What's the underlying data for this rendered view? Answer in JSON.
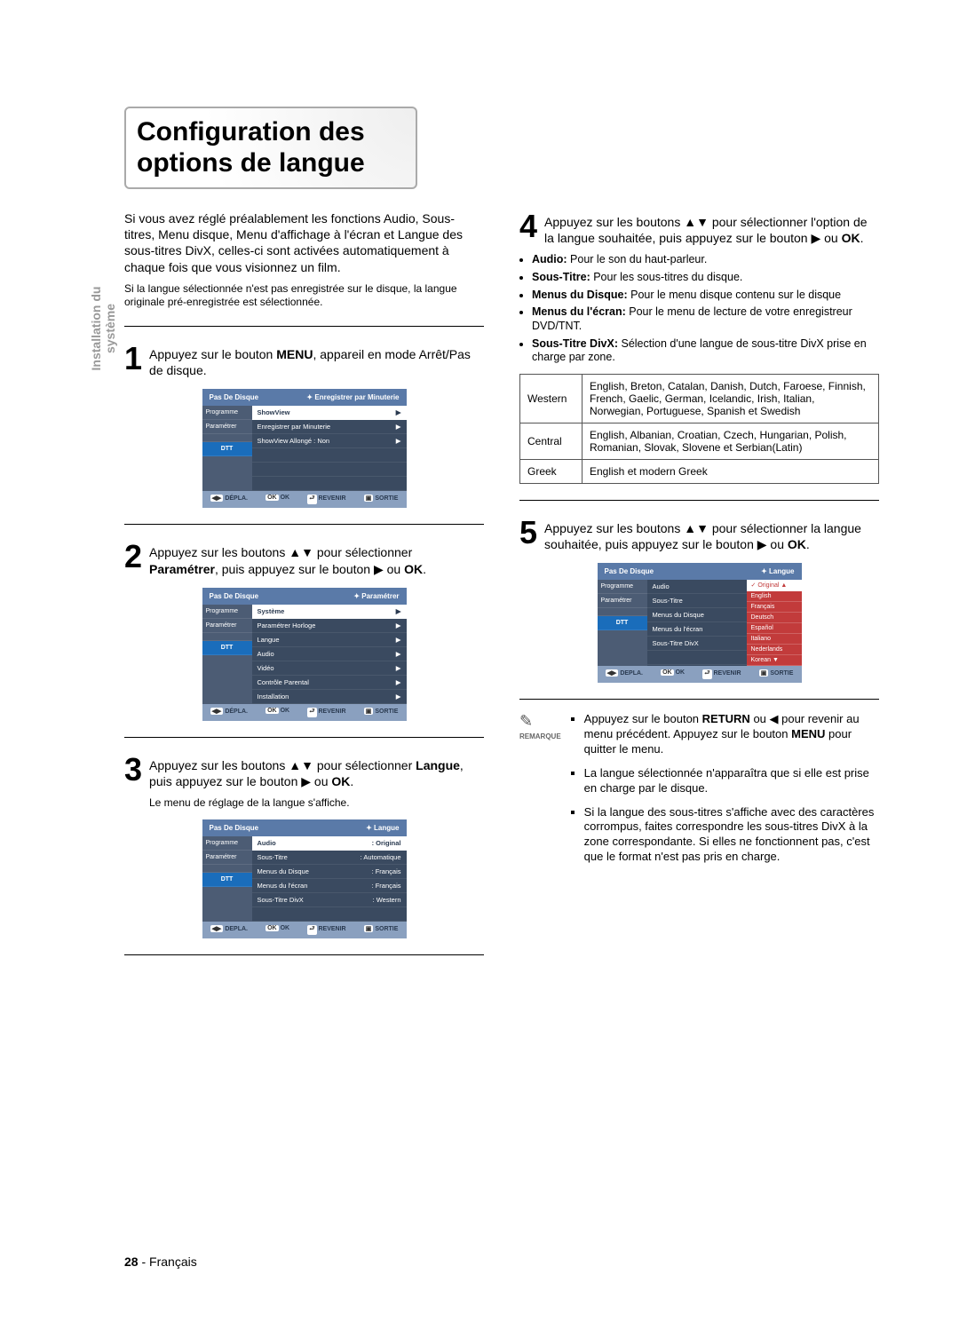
{
  "side_label": "Installation du système",
  "title": "Configuration des options de langue",
  "intro": "Si vous avez réglé préalablement les fonctions Audio, Sous-titres, Menu disque, Menu d'affichage à l'écran et Langue des sous-titres DivX, celles-ci sont activées automatiquement à chaque fois que vous visionnez un film.",
  "intro_small": "Si la langue sélectionnée n'est pas enregistrée sur le disque, la langue originale pré-enregistrée est sélectionnée.",
  "steps": {
    "s1": {
      "n": "1",
      "t": "Appuyez sur le bouton <b>MENU</b>, appareil en mode Arrêt/Pas de disque."
    },
    "s2": {
      "n": "2",
      "t": "Appuyez sur les boutons ▲▼ pour sélectionner <b>Paramétrer</b>, puis appuyez sur le bouton ▶ ou <b>OK</b>."
    },
    "s3": {
      "n": "3",
      "t": "Appuyez sur les boutons ▲▼ pour sélectionner <b>Langue</b>, puis appuyez sur le bouton ▶ ou <b>OK</b>.",
      "sub": "Le menu de réglage de la langue s'affiche."
    },
    "s4": {
      "n": "4",
      "t": "Appuyez sur les boutons ▲▼ pour sélectionner l'option de la langue souhaitée, puis appuyez sur le bouton ▶ ou <b>OK</b>."
    },
    "s5": {
      "n": "5",
      "t": "Appuyez sur les boutons ▲▼ pour sélectionner la langue souhaitée, puis appuyez sur le bouton ▶ ou <b>OK</b>."
    }
  },
  "bullets": [
    {
      "b": "Audio:",
      "t": " Pour le son du haut-parleur."
    },
    {
      "b": "Sous-Titre:",
      "t": " Pour les sous-titres du disque."
    },
    {
      "b": "Menus du Disque:",
      "t": " Pour le menu disque contenu sur le disque"
    },
    {
      "b": "Menus du l'écran:",
      "t": " Pour le menu de lecture de votre enregistreur DVD/TNT."
    },
    {
      "b": "Sous-Titre DivX:",
      "t": " Sélection d'une langue de sous-titre DivX prise en charge par zone."
    }
  ],
  "zones": [
    {
      "k": "Western",
      "v": "English, Breton, Catalan, Danish, Dutch, Faroese, Finnish, French, Gaelic, German, Icelandic, Irish, Italian, Norwegian, Portuguese, Spanish et Swedish"
    },
    {
      "k": "Central",
      "v": "English, Albanian, Croatian, Czech, Hungarian, Polish, Romanian, Slovak, Slovene et Serbian(Latin)"
    },
    {
      "k": "Greek",
      "v": "English et modern Greek"
    }
  ],
  "notes": [
    "Appuyez sur le bouton <b>RETURN</b> ou ◀ pour revenir au menu précédent. Appuyez sur le bouton <b>MENU</b> pour quitter le menu.",
    "La langue sélectionnée n'apparaîtra que si elle est prise en charge par le disque.",
    "Si la langue des sous-titres s'affiche avec des caractères corrompus, faites correspondre les sous-titres DivX à la zone correspondante. Si elles ne fonctionnent pas, c'est que le format n'est pas pris en charge."
  ],
  "osd": {
    "header_left": "Pas De Disque",
    "crumb": {
      "rec": "Enregistrer par Minuterie",
      "param": "Paramétrer",
      "lang": "Langue"
    },
    "left_tabs": [
      "Programme",
      "Paramétrer",
      "",
      "DTT"
    ],
    "menu1": [
      "ShowView",
      "Enregistrer par Minuterie",
      "ShowView Allongé : Non"
    ],
    "menu2": [
      "Système",
      "Paramétrer Horloge",
      "Langue",
      "Audio",
      "Vidéo",
      "Contrôle Parental",
      "Installation"
    ],
    "menu3": [
      {
        "l": "Audio",
        "r": ": Original"
      },
      {
        "l": "Sous-Titre",
        "r": ": Automatique"
      },
      {
        "l": "Menus du Disque",
        "r": ": Français"
      },
      {
        "l": "Menus du l'écran",
        "r": ": Français"
      },
      {
        "l": "Sous-Titre DivX",
        "r": ": Western"
      }
    ],
    "menu5_mid": [
      "Audio",
      "Sous-Titre",
      "Menus du Disque",
      "Menus du l'écran",
      "Sous-Titre DivX"
    ],
    "menu5_opts": [
      "Original",
      "English",
      "Français",
      "Deutsch",
      "Español",
      "Italiano",
      "Nederlands",
      "Korean"
    ],
    "footer": {
      "a": "DEPLA.",
      "b": "OK",
      "c": "REVENIR",
      "d": "SORTIE"
    },
    "footer_alt_a": "DÉPLA."
  },
  "remark_label": "REMARQUE",
  "page_footer": {
    "num": "28",
    "sep": " - ",
    "lang": "Français"
  }
}
